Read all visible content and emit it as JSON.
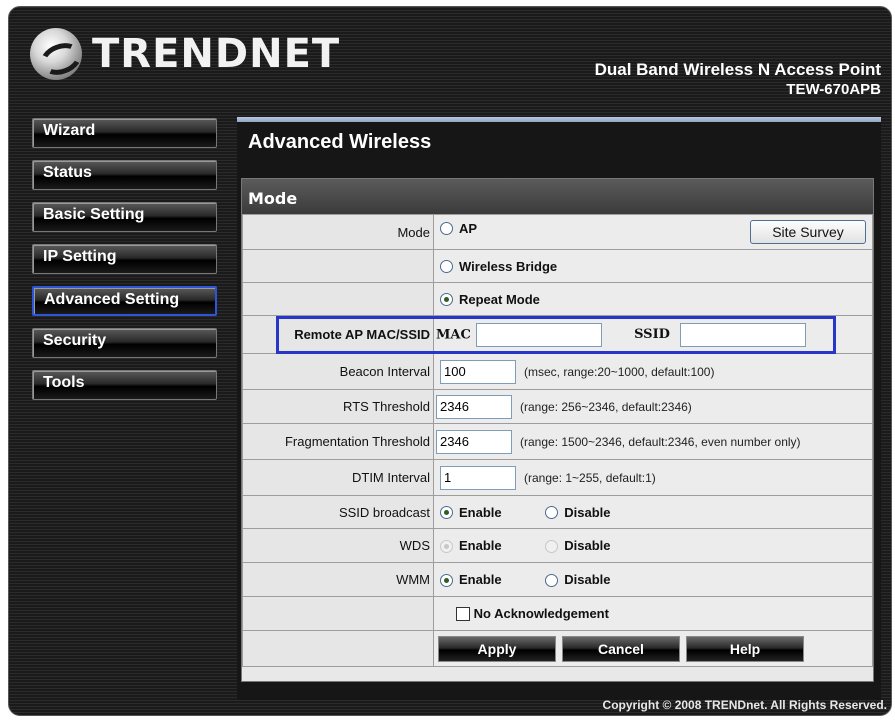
{
  "brand": {
    "logo_text": "TRENDNET",
    "product_line1": "Dual Band Wireless N Access Point",
    "product_line2": "TEW-670APB"
  },
  "nav": {
    "items": [
      "Wizard",
      "Status",
      "Basic Setting",
      "IP Setting",
      "Advanced Setting",
      "Security",
      "Tools"
    ],
    "active": "Advanced Setting"
  },
  "page": {
    "title": "Advanced Wireless",
    "section": "Mode"
  },
  "form": {
    "mode_label": "Mode",
    "mode_options": [
      "AP",
      "Wireless Bridge",
      "Repeat Mode"
    ],
    "mode_selected": "Repeat Mode",
    "site_survey": "Site Survey",
    "remote_label": "Remote AP MAC/SSID",
    "mac_label": "MAC",
    "mac_value": "",
    "ssid_label": "SSID",
    "ssid_value": "",
    "beacon_label": "Beacon Interval",
    "beacon_value": "100",
    "beacon_hint": "(msec, range:20~1000, default:100)",
    "rts_label": "RTS Threshold",
    "rts_value": "2346",
    "rts_hint": "(range: 256~2346, default:2346)",
    "frag_label": "Fragmentation Threshold",
    "frag_value": "2346",
    "frag_hint": "(range: 1500~2346, default:2346, even number only)",
    "dtim_label": "DTIM Interval",
    "dtim_value": "1",
    "dtim_hint": "(range: 1~255, default:1)",
    "ssid_broadcast_label": "SSID broadcast",
    "wds_label": "WDS",
    "wmm_label": "WMM",
    "enable": "Enable",
    "disable": "Disable",
    "no_ack": "No Acknowledgement",
    "apply": "Apply",
    "cancel": "Cancel",
    "help": "Help"
  },
  "copyright": "Copyright © 2008 TRENDnet. All Rights Reserved.",
  "colors": {
    "highlight": "#2835c9",
    "active_nav_border": "#2f55d6"
  }
}
